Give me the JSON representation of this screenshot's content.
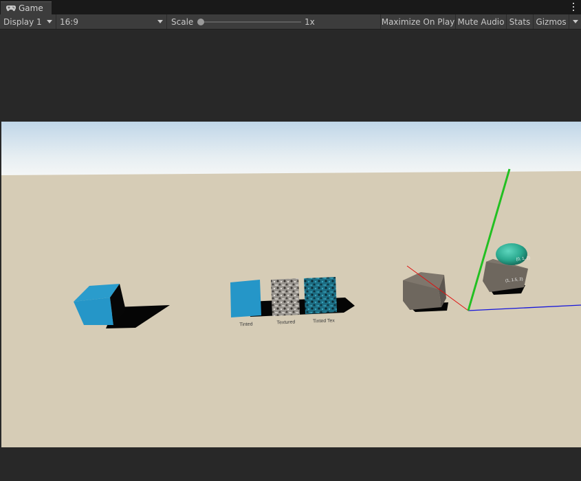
{
  "tab": {
    "label": "Game",
    "icon": "gamepad-icon"
  },
  "toolbar": {
    "display": "Display 1",
    "aspect": "16:9",
    "scale_label": "Scale",
    "scale_value": "1x",
    "maximize_on_play": "Maximize On Play",
    "mute_audio": "Mute Audio",
    "stats": "Stats",
    "gizmos": "Gizmos"
  },
  "scene": {
    "cube_labels": {
      "tinted": "Tinted",
      "textured": "Textured",
      "tinted_tex": "Tinted Tex"
    },
    "position_labels": {
      "sphere": "(0, 1, 2)",
      "grey_cube": "(1, 1.5, 2)"
    },
    "colors": {
      "sky_top": "#c8dcec",
      "horizon": "#f2f6f8",
      "ground": "#d6ccb6",
      "blue_cube": "#2596c8",
      "grey_cube": "#7a7268",
      "sphere": "#2aa88e",
      "axis_x": "#e01010",
      "axis_y": "#22c022",
      "axis_z": "#1414dc"
    }
  }
}
